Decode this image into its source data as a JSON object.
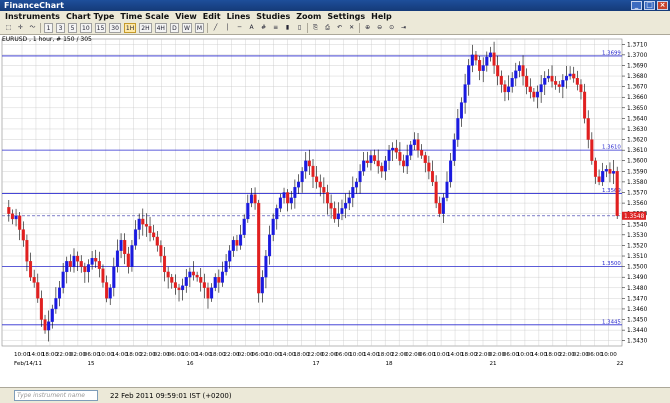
{
  "window": {
    "title": "FinanceChart"
  },
  "menu": [
    "Instruments",
    "Chart Type",
    "Time Scale",
    "View",
    "Edit",
    "Lines",
    "Studies",
    "Zoom",
    "Settings",
    "Help"
  ],
  "toolbar": {
    "timeframes": [
      "1",
      "3",
      "5",
      "10",
      "15",
      "30",
      "1H",
      "2H",
      "4H",
      "D",
      "W",
      "M"
    ],
    "selected_timeframe": "1H"
  },
  "chart_label": "EURUSD , 1 hour, # 150 / 305",
  "status": {
    "instrument_placeholder": "Type instrument name",
    "clock": "22 Feb 2011 09:59:01  IST (+0200)"
  },
  "chart_data": {
    "type": "candlestick",
    "instrument": "EURUSD",
    "ylim": [
      1.3425,
      1.3715
    ],
    "yticks": [
      "1.3430",
      "1.3440",
      "1.3450",
      "1.3460",
      "1.3470",
      "1.3480",
      "1.3490",
      "1.3500",
      "1.3510",
      "1.3520",
      "1.3530",
      "1.3540",
      "1.3550",
      "1.3560",
      "1.3570",
      "1.3580",
      "1.3590",
      "1.3600",
      "1.3610",
      "1.3620",
      "1.3630",
      "1.3640",
      "1.3650",
      "1.3660",
      "1.3670",
      "1.3680",
      "1.3690",
      "1.3700",
      "1.3710"
    ],
    "xticks": [
      "10:00",
      "14:00",
      "18:00",
      "22:00",
      "02:00",
      "06:00",
      "10:00",
      "14:00",
      "18:00",
      "22:00",
      "02:00",
      "06:00",
      "10:00",
      "14:00",
      "18:00",
      "22:00",
      "02:00",
      "06:00",
      "10:00",
      "14:00",
      "18:00",
      "22:00",
      "02:00",
      "06:00",
      "10:00",
      "14:00",
      "18:00",
      "22:00",
      "02:00",
      "06:00",
      "10:00",
      "14:00",
      "18:00",
      "22:00",
      "02:00",
      "06:00",
      "10:00",
      "14:00",
      "18:00",
      "22:00",
      "02:00",
      "06:00",
      "10:00"
    ],
    "day_labels": [
      "Feb/14/11",
      "15",
      "16",
      "17",
      "18",
      "21",
      "22"
    ],
    "horizontal_lines": [
      {
        "value": 1.3699,
        "label": "1.3699"
      },
      {
        "value": 1.361,
        "label": "1.3610"
      },
      {
        "value": 1.3569,
        "label": "1.3569"
      },
      {
        "value": 1.35,
        "label": "1.3500"
      },
      {
        "value": 1.3445,
        "label": "1.3445"
      }
    ],
    "current_price": {
      "value": 1.3548,
      "label": "1.3548"
    },
    "colors": {
      "up": "#1a1adf",
      "down": "#e02020",
      "grid": "#c8c8c8",
      "level": "#2b2bd0",
      "last_price": "#dd2222"
    },
    "closes": [
      1.355,
      1.3545,
      1.3548,
      1.3535,
      1.3525,
      1.3505,
      1.349,
      1.3485,
      1.347,
      1.345,
      1.344,
      1.3448,
      1.346,
      1.347,
      1.348,
      1.3495,
      1.3505,
      1.35,
      1.351,
      1.3505,
      1.35,
      1.3495,
      1.3502,
      1.3508,
      1.3505,
      1.3498,
      1.3485,
      1.347,
      1.348,
      1.35,
      1.3515,
      1.3525,
      1.3512,
      1.35,
      1.352,
      1.3535,
      1.3545,
      1.354,
      1.3538,
      1.3532,
      1.3528,
      1.352,
      1.351,
      1.3495,
      1.349,
      1.3485,
      1.348,
      1.3478,
      1.3482,
      1.349,
      1.3495,
      1.3492,
      1.349,
      1.3485,
      1.348,
      1.347,
      1.348,
      1.349,
      1.3485,
      1.3495,
      1.3505,
      1.3515,
      1.3525,
      1.352,
      1.353,
      1.3545,
      1.356,
      1.3568,
      1.356,
      1.3475,
      1.349,
      1.351,
      1.353,
      1.3545,
      1.3555,
      1.3565,
      1.357,
      1.356,
      1.3565,
      1.3575,
      1.358,
      1.359,
      1.36,
      1.3595,
      1.3585,
      1.358,
      1.3575,
      1.357,
      1.356,
      1.3555,
      1.3545,
      1.355,
      1.3555,
      1.356,
      1.3565,
      1.3575,
      1.358,
      1.359,
      1.36,
      1.3598,
      1.3605,
      1.36,
      1.3595,
      1.359,
      1.36,
      1.361,
      1.3612,
      1.3608,
      1.36,
      1.3595,
      1.3605,
      1.3615,
      1.362,
      1.361,
      1.3605,
      1.3598,
      1.359,
      1.358,
      1.356,
      1.355,
      1.3565,
      1.358,
      1.36,
      1.362,
      1.364,
      1.3655,
      1.3672,
      1.369,
      1.37,
      1.3695,
      1.3685,
      1.369,
      1.3698,
      1.3702,
      1.369,
      1.368,
      1.3672,
      1.3665,
      1.367,
      1.3678,
      1.3685,
      1.369,
      1.368,
      1.367,
      1.3665,
      1.366,
      1.3665,
      1.3672,
      1.3678,
      1.368,
      1.3675,
      1.3672,
      1.367,
      1.3676,
      1.368,
      1.3682,
      1.3678,
      1.3672,
      1.3665,
      1.364,
      1.362,
      1.36,
      1.3585,
      1.358,
      1.359,
      1.3592,
      1.3588,
      1.359,
      1.3548
    ]
  }
}
